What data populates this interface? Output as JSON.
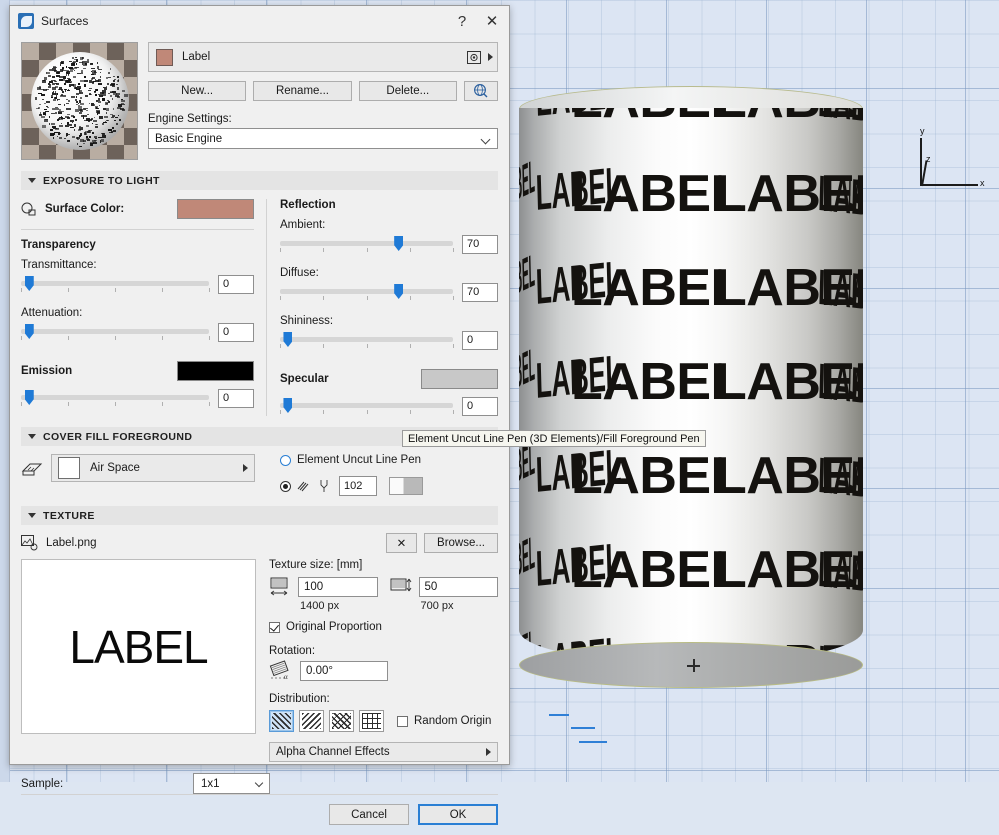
{
  "window": {
    "title": "Surfaces",
    "icon": "surfaces-app-icon",
    "help_label": "?",
    "close_label": "✕"
  },
  "surface": {
    "name": "Label",
    "swatch_color": "#c08878",
    "preview_icon": "sphere-preview",
    "picture_icon": "picture-icon"
  },
  "actions": {
    "new": "New...",
    "rename": "Rename...",
    "delete": "Delete...",
    "globe_icon": "globe-search-icon"
  },
  "engine": {
    "label": "Engine Settings:",
    "value": "Basic Engine",
    "options": [
      "Basic Engine"
    ]
  },
  "exposure": {
    "section_title": "EXPOSURE TO LIGHT",
    "surface_color_label": "Surface Color:",
    "surface_color_value": "#c08878",
    "transparency_title": "Transparency",
    "transmittance_label": "Transmittance:",
    "transmittance_value": "0",
    "attenuation_label": "Attenuation:",
    "attenuation_value": "0",
    "emission_label": "Emission",
    "emission_color": "#000000",
    "emission_value": "0",
    "reflection_title": "Reflection",
    "ambient_label": "Ambient:",
    "ambient_value": "70",
    "diffuse_label": "Diffuse:",
    "diffuse_value": "70",
    "shininess_label": "Shininess:",
    "shininess_value": "0",
    "specular_label": "Specular",
    "specular_color": "#c8c8c8",
    "specular_value": "0"
  },
  "cover_fill": {
    "section_title": "COVER FILL FOREGROUND",
    "fill_icon": "fill-pattern-icon",
    "fill_name": "Air Space",
    "fill_swatch": "#ffffff",
    "uncut_pen_label": "Element Uncut Line Pen",
    "uncut_pen_selected": false,
    "custom_pen_selected": true,
    "pen_number": "102",
    "pen_icon": "pen-line-icon",
    "pen_swatch_icon": "pen-color-swatch"
  },
  "tooltip": {
    "text": "Element Uncut Line Pen (3D Elements)/Fill Foreground Pen"
  },
  "texture": {
    "section_title": "TEXTURE",
    "file_icon": "texture-image-icon",
    "file_name": "Label.png",
    "clear_label": "✕",
    "browse_label": "Browse...",
    "preview_text": "LABEL",
    "size_label": "Texture size: [mm]",
    "width_icon": "texture-width-icon",
    "width_value": "100",
    "width_px": "1400 px",
    "height_icon": "texture-height-icon",
    "height_value": "50",
    "height_px": "700 px",
    "original_proportion_label": "Original Proportion",
    "original_proportion_checked": true,
    "rotation_label": "Rotation:",
    "rotation_icon": "texture-rotation-icon",
    "rotation_value": "0.00°",
    "distribution_label": "Distribution:",
    "distribution_options": [
      "distribution-tile-icon",
      "distribution-mirror-x-icon",
      "distribution-mirror-y-icon",
      "distribution-mirror-both-icon"
    ],
    "distribution_selected": 0,
    "random_origin_label": "Random Origin",
    "random_origin_checked": false,
    "alpha_label": "Alpha Channel Effects",
    "sample_label": "Sample:",
    "sample_value": "1x1",
    "sample_options": [
      "1x1"
    ]
  },
  "footer": {
    "cancel": "Cancel",
    "ok": "OK"
  },
  "viewport": {
    "model_label": "LABEL",
    "axis_x": "x",
    "axis_y": "y",
    "axis_z": "z",
    "background_color": "#dce5f3",
    "cursor_icon": "crosshair-cursor"
  }
}
